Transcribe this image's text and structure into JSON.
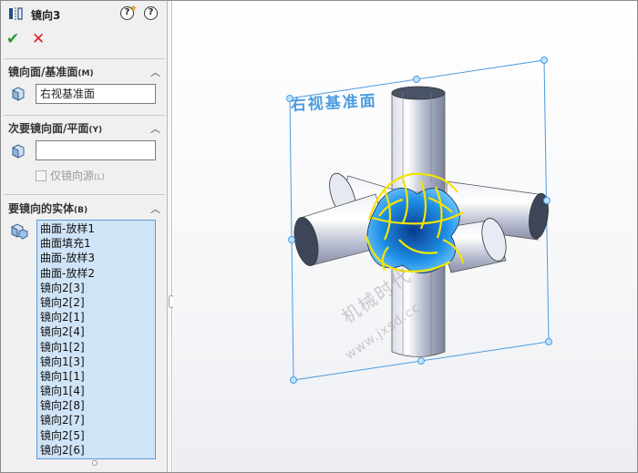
{
  "panel": {
    "title": "镜向3",
    "help_label": "?",
    "sections": {
      "mirror_face": {
        "label": "镜向面/基准面",
        "shortcut": "(M)",
        "value": "右视基准面"
      },
      "secondary": {
        "label": "次要镜向面/平面",
        "shortcut": "(Y)",
        "value": "",
        "checkbox_label": "仅镜向源",
        "checkbox_shortcut": "(L)"
      },
      "bodies": {
        "label": "要镜向的实体",
        "shortcut": "(B)",
        "items": [
          "曲面-放样1",
          "曲面填充1",
          "曲面-放样3",
          "曲面-放样2",
          "镜向2[3]",
          "镜向2[2]",
          "镜向2[1]",
          "镜向2[4]",
          "镜向1[2]",
          "镜向1[3]",
          "镜向1[1]",
          "镜向1[4]",
          "镜向2[8]",
          "镜向2[7]",
          "镜向2[5]",
          "镜向2[6]"
        ]
      }
    },
    "colors": {
      "ok": "#2f9a2f",
      "cancel": "#dd2222",
      "list_bg": "#cfe4f7"
    }
  },
  "viewport": {
    "plane_name": "右视基准面",
    "watermark_1": "机械时代",
    "watermark_2": "www.jxsd.cc",
    "colors": {
      "plane": "#4b9be0",
      "selection": "#f4e400",
      "surface": "#b9bfd2",
      "face_blue": "#1e8fe6"
    }
  }
}
